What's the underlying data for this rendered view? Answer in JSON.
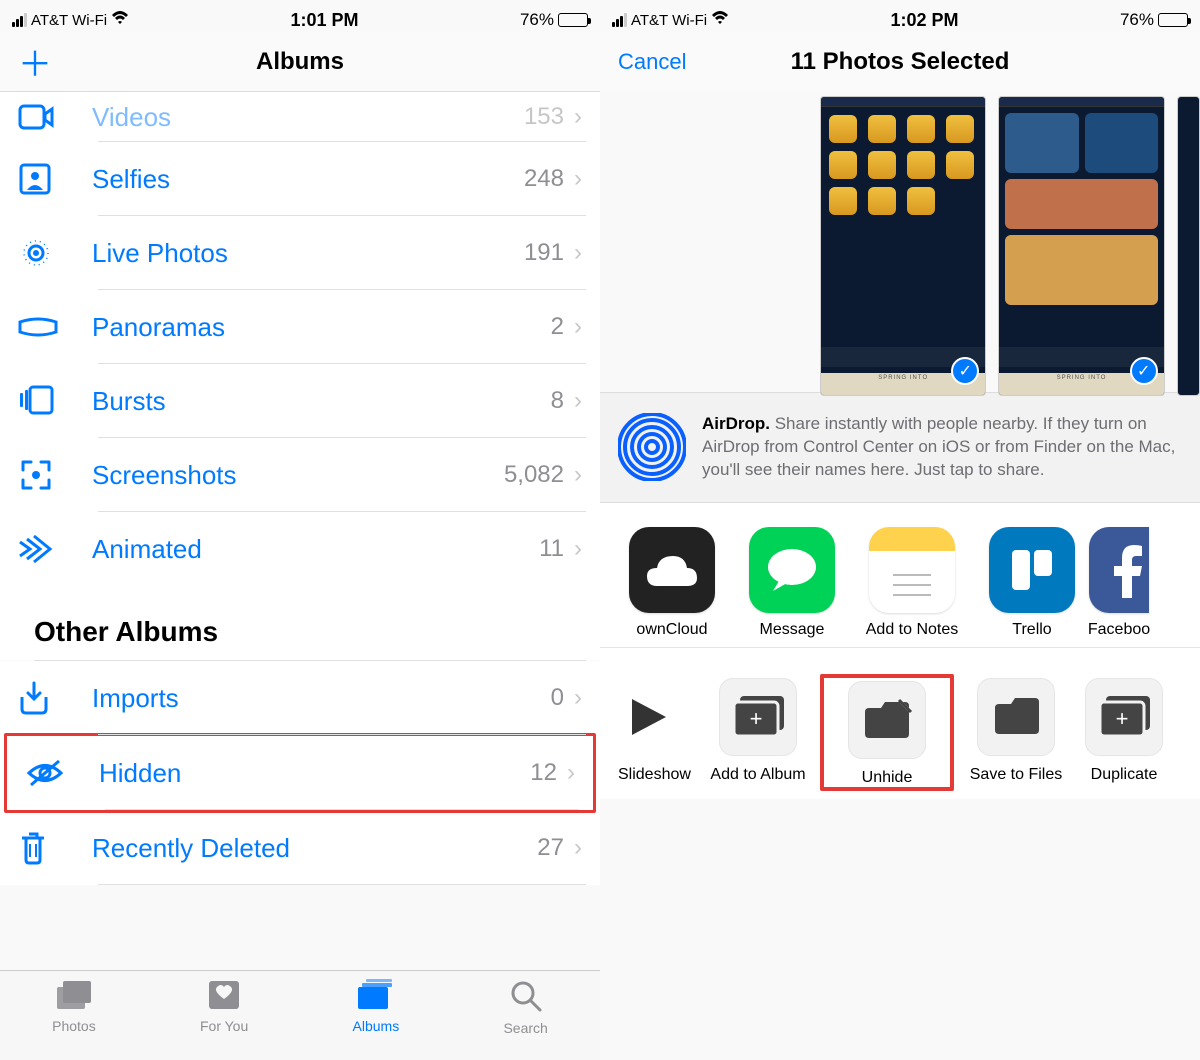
{
  "left": {
    "status": {
      "carrier": "AT&T Wi-Fi",
      "time": "1:01 PM",
      "battery": "76%"
    },
    "nav": {
      "title": "Albums",
      "add": "＋"
    },
    "media_types": [
      {
        "name": "Videos",
        "label": "Videos",
        "count": "153",
        "icon": "videos-icon",
        "faded": true
      },
      {
        "name": "Selfies",
        "label": "Selfies",
        "count": "248",
        "icon": "selfies-icon"
      },
      {
        "name": "Live Photos",
        "label": "Live Photos",
        "count": "191",
        "icon": "live-photos-icon"
      },
      {
        "name": "Panoramas",
        "label": "Panoramas",
        "count": "2",
        "icon": "panoramas-icon"
      },
      {
        "name": "Bursts",
        "label": "Bursts",
        "count": "8",
        "icon": "bursts-icon"
      },
      {
        "name": "Screenshots",
        "label": "Screenshots",
        "count": "5,082",
        "icon": "screenshots-icon"
      },
      {
        "name": "Animated",
        "label": "Animated",
        "count": "11",
        "icon": "animated-icon"
      }
    ],
    "other_section": "Other Albums",
    "other_albums": [
      {
        "name": "Imports",
        "label": "Imports",
        "count": "0",
        "icon": "imports-icon"
      },
      {
        "name": "Hidden",
        "label": "Hidden",
        "count": "12",
        "icon": "hidden-icon",
        "highlight": true
      },
      {
        "name": "Recently Deleted",
        "label": "Recently Deleted",
        "count": "27",
        "icon": "trash-icon"
      }
    ],
    "tabs": [
      {
        "label": "Photos",
        "icon": "photos-tab-icon"
      },
      {
        "label": "For You",
        "icon": "foryou-tab-icon"
      },
      {
        "label": "Albums",
        "icon": "albums-tab-icon",
        "active": true
      },
      {
        "label": "Search",
        "icon": "search-tab-icon"
      }
    ]
  },
  "right": {
    "status": {
      "carrier": "AT&T Wi-Fi",
      "time": "1:02 PM",
      "battery": "76%"
    },
    "nav": {
      "cancel": "Cancel",
      "title": "11 Photos Selected"
    },
    "thumb_banner": "SPRING INTO",
    "airdrop": {
      "bold": "AirDrop.",
      "text": " Share instantly with people nearby. If they turn on AirDrop from Control Center on iOS or from Finder on the Mac, you'll see their names here. Just tap to share."
    },
    "share_apps": [
      {
        "label": "ownCloud",
        "icon": "owncloud-icon"
      },
      {
        "label": "Message",
        "icon": "message-icon"
      },
      {
        "label": "Add to Notes",
        "icon": "notes-icon"
      },
      {
        "label": "Trello",
        "icon": "trello-icon"
      },
      {
        "label": "Faceboo",
        "icon": "facebook-icon"
      }
    ],
    "actions": [
      {
        "label": "Slideshow",
        "icon": "play-icon"
      },
      {
        "label": "Add to Album",
        "icon": "add-album-icon"
      },
      {
        "label": "Unhide",
        "icon": "unhide-icon",
        "highlight": true
      },
      {
        "label": "Save to Files",
        "icon": "save-files-icon"
      },
      {
        "label": "Duplicate",
        "icon": "duplicate-icon"
      }
    ]
  }
}
